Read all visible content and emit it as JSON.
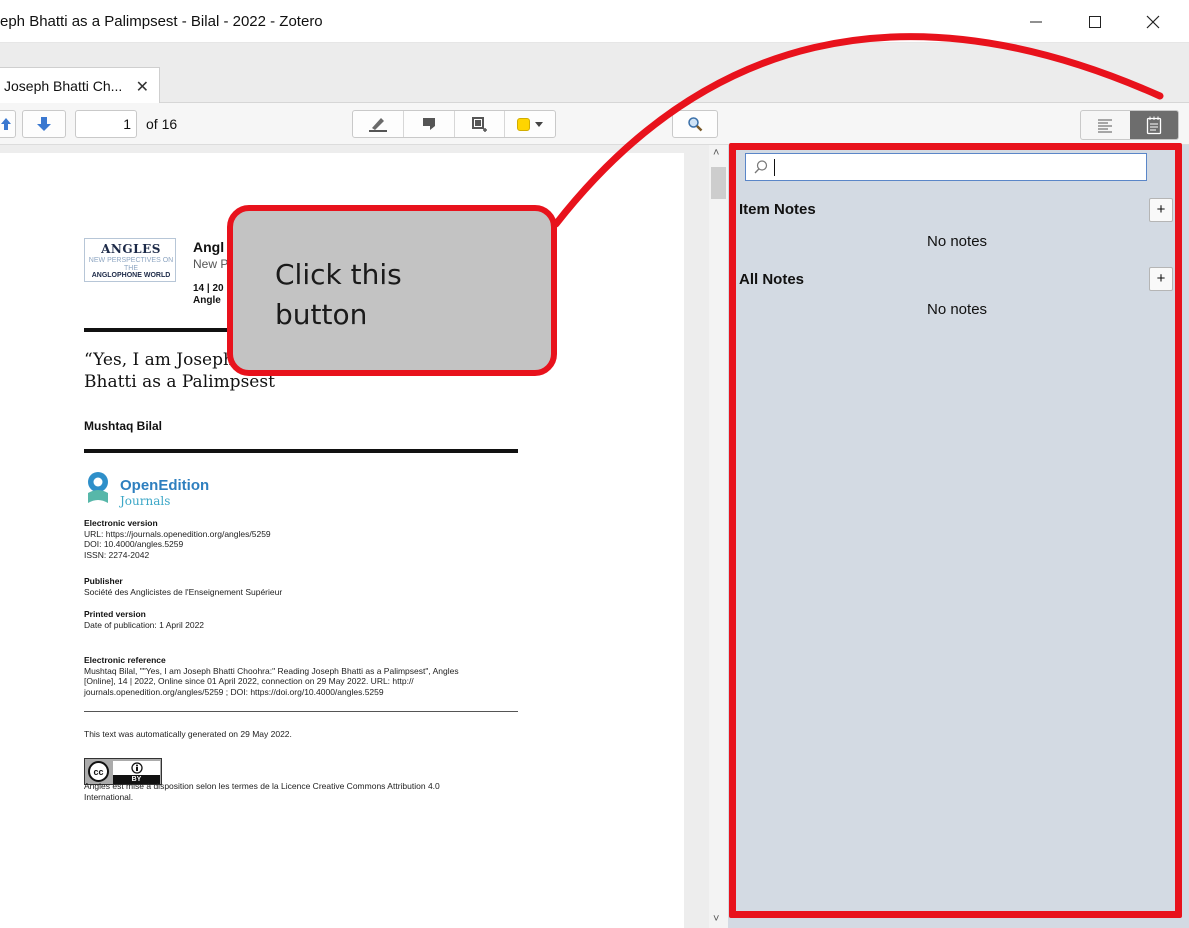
{
  "window": {
    "title": "eph Bhatti as a Palimpsest - Bilal - 2022 - Zotero",
    "minimize": "—",
    "maximize": "☐",
    "close": "✕"
  },
  "tabs": [
    {
      "label": "Joseph Bhatti Ch...",
      "close": "✕"
    }
  ],
  "toolbar": {
    "page_value": "1",
    "page_of": "of 16",
    "highlight_color": "#ffd400"
  },
  "pdf": {
    "logo_line1": "ANGLES",
    "logo_line2": "NEW PERSPECTIVES ON THE",
    "logo_line3": "ANGLOPHONE WORLD",
    "journal_name": "Angl",
    "journal_sub": "New P",
    "journal_issue": "14 | 20",
    "journal_issue2": "Angle",
    "article_title_line1": "“Yes, I am Joseph",
    "article_title_line2": "Bhatti as a Palimpsest",
    "author": "Mushtaq Bilal",
    "oe_name": "OpenEdition",
    "oe_sub": "Journals",
    "electronic_version_label": "Electronic version",
    "electronic_version_lines": [
      "URL: https://journals.openedition.org/angles/5259",
      "DOI: 10.4000/angles.5259",
      "ISSN: 2274-2042"
    ],
    "publisher_label": "Publisher",
    "publisher_value": "Société des Anglicistes de l'Enseignement Supérieur",
    "printed_label": "Printed version",
    "printed_value": "Date of publication: 1 April 2022",
    "reference_label": "Electronic reference",
    "reference_lines": [
      "Mushtaq Bilal, \"\"Yes, I am Joseph Bhatti Choohra:\" Reading Joseph Bhatti as a Palimpsest\", Angles",
      "[Online], 14 | 2022, Online since 01 April 2022, connection on 29 May 2022. URL: http://",
      "journals.openedition.org/angles/5259 ; DOI: https://doi.org/10.4000/angles.5259"
    ],
    "generated_note": "This text was automatically generated on 29 May 2022.",
    "cc_label": "cc",
    "cc_by": "BY",
    "license_line1": "Angles est mise à disposition selon les termes de la Licence Creative Commons Attribution 4.0",
    "license_line2": "International."
  },
  "notes": {
    "search_placeholder": "",
    "item_notes_label": "Item Notes",
    "item_notes_empty": "No notes",
    "all_notes_label": "All Notes",
    "all_notes_empty": "No notes",
    "add": "+"
  },
  "annotation": {
    "callout_line1": "Click this",
    "callout_line2": "button",
    "accent_color": "#e8121c"
  }
}
